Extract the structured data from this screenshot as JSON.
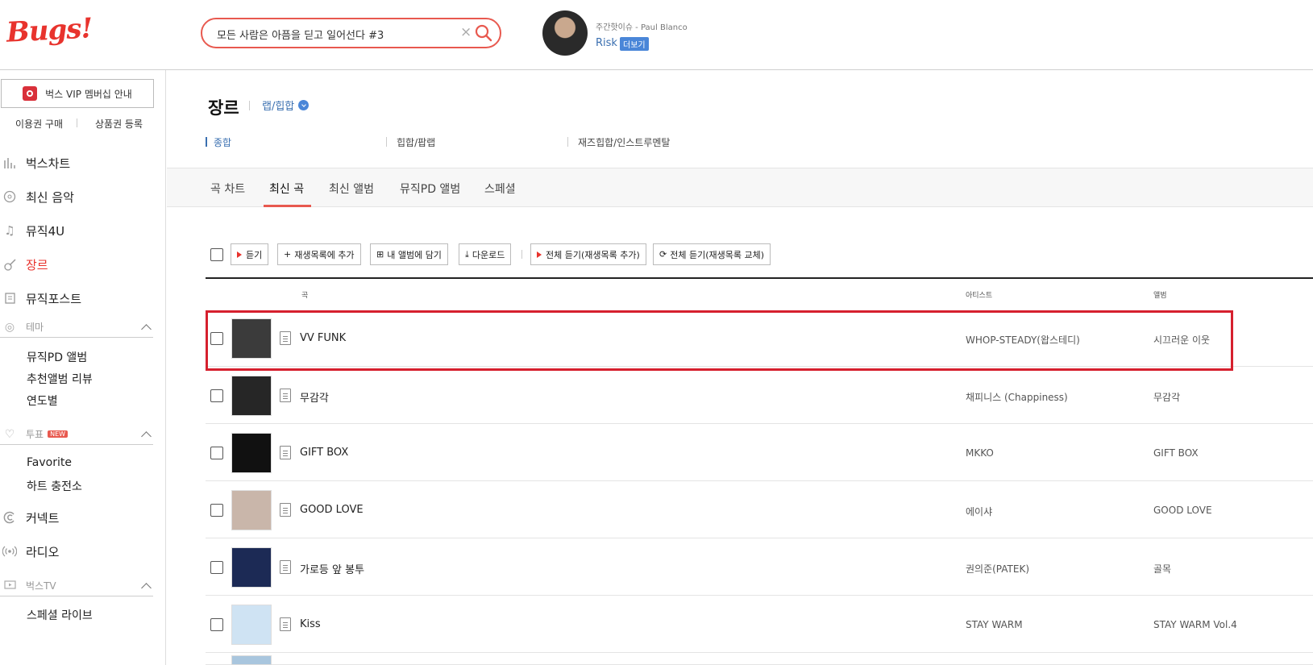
{
  "header": {
    "logo": "Bugs!",
    "search_value": "모든 사람은 아픔을 딛고 일어선다 #3",
    "promo": {
      "subtitle": "주간핫이슈 - Paul Blanco",
      "title": "Risk",
      "more_label": "더보기"
    }
  },
  "sidebar": {
    "vip_label": "벅스 VIP 멤버십 안내",
    "buy_pass": "이용권 구매",
    "register_coupon": "상품권 등록",
    "items": [
      {
        "label": "벅스차트",
        "icon": "chart-icon"
      },
      {
        "label": "최신 음악",
        "icon": "new-music-icon"
      },
      {
        "label": "뮤직4U",
        "icon": "music-note-icon"
      },
      {
        "label": "장르",
        "icon": "guitar-icon"
      },
      {
        "label": "뮤직포스트",
        "icon": "post-icon"
      }
    ],
    "theme": {
      "label": "테마",
      "items": [
        "뮤직PD 앨범",
        "추천앨범 리뷰",
        "연도별"
      ]
    },
    "vote": {
      "label": "투표",
      "badge": "NEW",
      "items": [
        "Favorite",
        "하트 충전소"
      ]
    },
    "connect": "커넥트",
    "radio": "라디오",
    "bugstv": {
      "label": "벅스TV",
      "items": [
        "스페셜 라이브"
      ]
    }
  },
  "main": {
    "page_title": "장르",
    "genre_select": "랩/힙합",
    "subgenres": [
      "종합",
      "힙합/팝랩",
      "재즈힙합/인스트루멘탈"
    ],
    "tabs": [
      "곡 차트",
      "최신 곡",
      "최신 앨범",
      "뮤직PD 앨범",
      "스페셜"
    ],
    "active_tab": "최신 곡",
    "toolbar": {
      "listen": "듣기",
      "add_playlist": "재생목록에 추가",
      "add_album": "내 앨범에 담기",
      "download": "다운로드",
      "listen_all_add": "전체 듣기(재생목록 추가)",
      "listen_all_replace": "전체 듣기(재생목록 교체)"
    },
    "columns": {
      "song": "곡",
      "artist": "아티스트",
      "album": "앨범"
    },
    "songs": [
      {
        "title": "VV FUNK",
        "artist": "WHOP-STEADY(왑스테디)",
        "album": "시끄러운 이웃",
        "cover": "#3b3b3b"
      },
      {
        "title": "무감각",
        "artist": "채피니스 (Chappiness)",
        "album": "무감각",
        "cover": "#262626"
      },
      {
        "title": "GIFT BOX",
        "artist": "MKKO",
        "album": "GIFT BOX",
        "cover": "#111111"
      },
      {
        "title": "GOOD LOVE",
        "artist": "에이샤",
        "album": "GOOD LOVE",
        "cover": "#c9b6aa"
      },
      {
        "title": "가로등 앞 봉투",
        "artist": "권의준(PATEK)",
        "album": "골목",
        "cover": "#1c2a55"
      },
      {
        "title": "Kiss",
        "artist": "STAY WARM",
        "album": "STAY WARM Vol.4",
        "cover": "#cfe3f3"
      }
    ]
  },
  "colors": {
    "brand": "#e8332d",
    "link": "#3a6fb0",
    "highlight": "#d6202e"
  }
}
